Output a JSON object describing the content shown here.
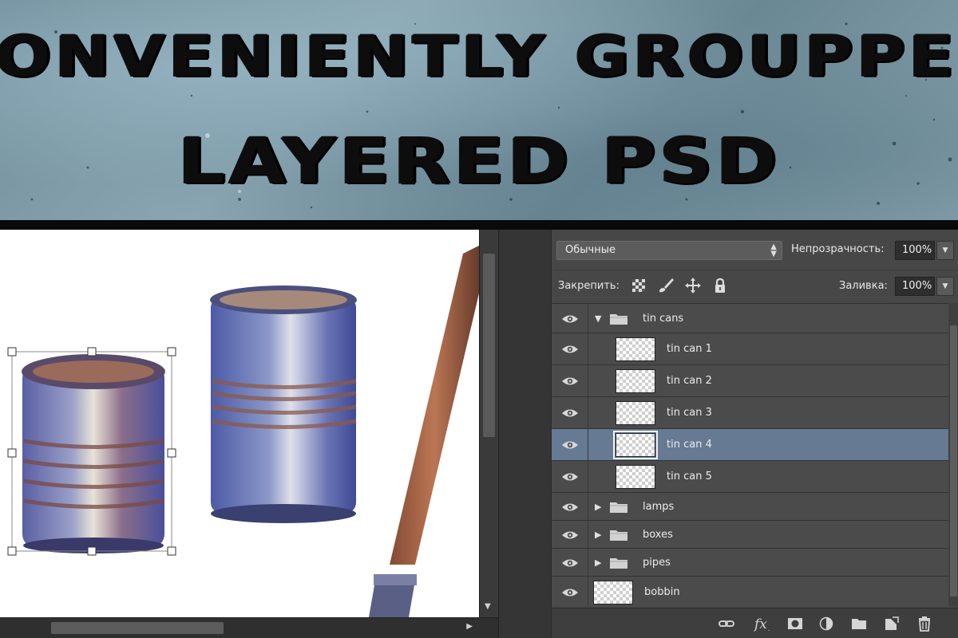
{
  "banner": {
    "line1": "CONVENIENTLY GROUPPED",
    "line2": "LAYERED PSD"
  },
  "layers_panel": {
    "blend_mode": "Обычные",
    "opacity_label": "Непрозрачность:",
    "opacity_value": "100%",
    "lock_label": "Закрепить:",
    "fill_label": "Заливка:",
    "fill_value": "100%",
    "layers": [
      {
        "name": "tin cans",
        "type": "group",
        "expanded": true,
        "level": 0,
        "selected": false
      },
      {
        "name": "tin can 1",
        "type": "layer",
        "level": 1,
        "selected": false
      },
      {
        "name": "tin can 2",
        "type": "layer",
        "level": 1,
        "selected": false
      },
      {
        "name": "tin can 3",
        "type": "layer",
        "level": 1,
        "selected": false
      },
      {
        "name": "tin can 4",
        "type": "layer",
        "level": 1,
        "selected": true
      },
      {
        "name": "tin can 5",
        "type": "layer",
        "level": 1,
        "selected": false
      },
      {
        "name": "lamps",
        "type": "group",
        "expanded": false,
        "level": 0,
        "selected": false
      },
      {
        "name": "boxes",
        "type": "group",
        "expanded": false,
        "level": 0,
        "selected": false
      },
      {
        "name": "pipes",
        "type": "group",
        "expanded": false,
        "level": 0,
        "selected": false
      },
      {
        "name": "bobbin",
        "type": "layer",
        "level": 0,
        "selected": false
      }
    ],
    "bottom_icons": [
      "link-icon",
      "fx-icon",
      "mask-icon",
      "adjustment-icon",
      "group-folder-icon",
      "new-layer-icon",
      "trash-icon"
    ]
  },
  "colors": {
    "selected_row": "#667a93",
    "panel_bg": "#474747"
  }
}
